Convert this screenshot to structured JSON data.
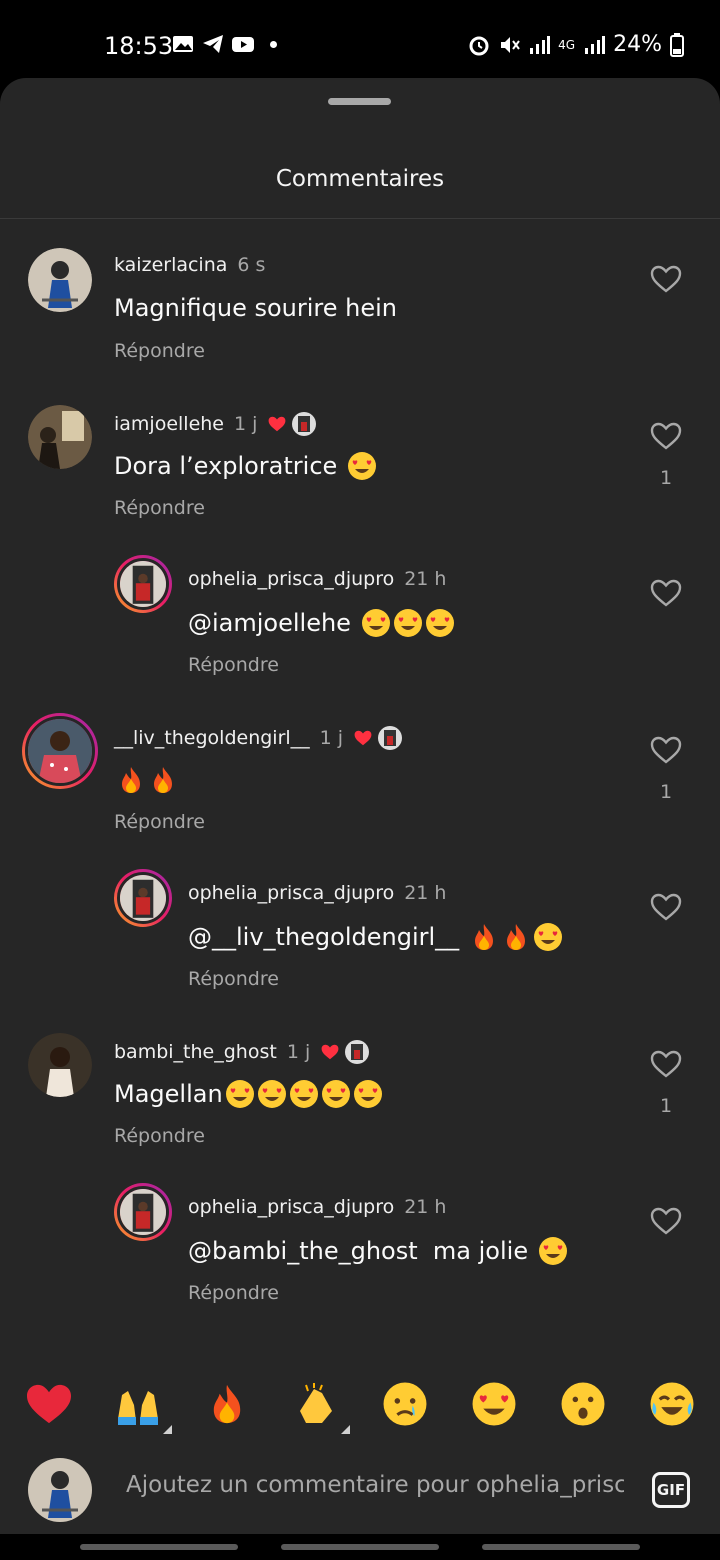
{
  "status": {
    "time": "18:53",
    "battery": "24%",
    "network": "4G"
  },
  "sheet": {
    "title": "Commentaires"
  },
  "comments": [
    {
      "user": "kaizerlacina",
      "time": "6 s",
      "text": "Magnifique sourire hein",
      "emojis": [],
      "reply": "Répondre",
      "likes": "",
      "author_liked": false
    },
    {
      "user": "iamjoellehe",
      "time": "1 j",
      "text": "Dora l’exploratrice",
      "emojis": [
        "heart-eyes"
      ],
      "reply": "Répondre",
      "likes": "1",
      "author_liked": true
    },
    {
      "user": "ophelia_prisca_djupro",
      "time": "21 h",
      "text": "@iamjoellehe",
      "emojis": [
        "heart-eyes",
        "heart-eyes",
        "heart-eyes"
      ],
      "reply": "Répondre",
      "likes": "",
      "author_liked": false
    },
    {
      "user": "__liv_thegoldengirl__",
      "time": "1 j",
      "text": "",
      "emojis": [
        "fire",
        "fire"
      ],
      "reply": "Répondre",
      "likes": "1",
      "author_liked": true
    },
    {
      "user": "ophelia_prisca_djupro",
      "time": "21 h",
      "text": "@__liv_thegoldengirl__",
      "emojis": [
        "fire",
        "fire",
        "heart-eyes"
      ],
      "reply": "Répondre",
      "likes": "",
      "author_liked": false
    },
    {
      "user": "bambi_the_ghost",
      "time": "1 j",
      "text": "Magellan",
      "emojis": [
        "heart-eyes",
        "heart-eyes",
        "heart-eyes",
        "heart-eyes",
        "heart-eyes"
      ],
      "reply": "Répondre",
      "likes": "1",
      "author_liked": true
    },
    {
      "user": "ophelia_prisca_djupro",
      "time": "21 h",
      "text": "@bambi_the_ghost  ma jolie",
      "emojis": [
        "heart-eyes"
      ],
      "reply": "Répondre",
      "likes": "",
      "author_liked": false
    }
  ],
  "reactions": [
    "red-heart",
    "raising-hands",
    "fire",
    "clapping-hands",
    "crying-face",
    "heart-eyes",
    "surprised-face",
    "tears-of-joy"
  ],
  "composer": {
    "placeholder": "Ajoutez un commentaire pour ophelia_prisca",
    "gif_label": "GIF"
  },
  "colors": {
    "sheet_bg": "#262626",
    "muted": "#a8a8a8",
    "heart_red": "#ff3040"
  }
}
